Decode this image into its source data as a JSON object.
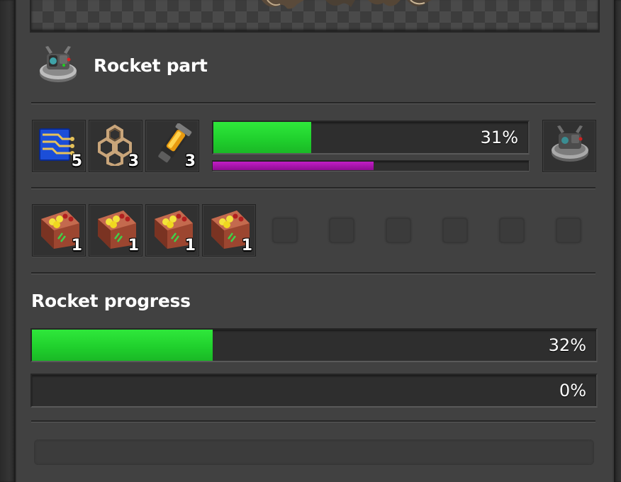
{
  "recipe": {
    "title": "Rocket part",
    "icon": "rocket-part-icon",
    "progress_percent": 31,
    "progress_label": "31%",
    "secondary_progress_percent": 51
  },
  "ingredients": [
    {
      "name": "processing-unit-icon",
      "count": "5"
    },
    {
      "name": "low-density-structure-icon",
      "count": "3"
    },
    {
      "name": "rocket-fuel-icon",
      "count": "3"
    }
  ],
  "output": {
    "name": "rocket-part-icon"
  },
  "modules": [
    {
      "name": "productivity-module-icon",
      "count": "1"
    },
    {
      "name": "productivity-module-icon",
      "count": "1"
    },
    {
      "name": "productivity-module-icon",
      "count": "1"
    },
    {
      "name": "productivity-module-icon",
      "count": "1"
    }
  ],
  "empty_module_slots": 6,
  "rocket": {
    "title": "Rocket progress",
    "progress_percent": 32,
    "progress_label": "32%",
    "second_progress_percent": 0,
    "second_progress_label": "0%"
  },
  "colors": {
    "progress_green": "#22d32f",
    "progress_purple": "#b418b8"
  }
}
